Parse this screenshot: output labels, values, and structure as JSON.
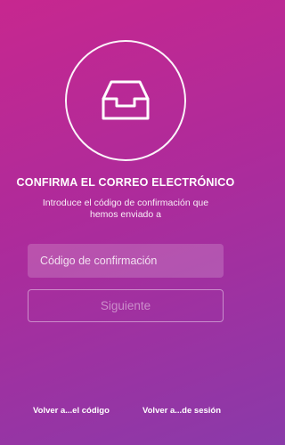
{
  "header": {
    "icon": "inbox-tray-icon",
    "title": "CONFIRMA EL CORREO ELECTRÓNICO",
    "subtitle_line1": "Introduce el código de confirmación que",
    "subtitle_line2": "hemos enviado a"
  },
  "form": {
    "code_input": {
      "value": "",
      "placeholder": "Código de confirmación"
    },
    "next_button_label": "Siguiente"
  },
  "footer": {
    "left_link": "Volver a...el código",
    "right_link": "Volver a...de sesión"
  },
  "colors": {
    "gradient_start": "#c7278f",
    "gradient_end": "#8a3aa9",
    "text": "#ffffff"
  }
}
